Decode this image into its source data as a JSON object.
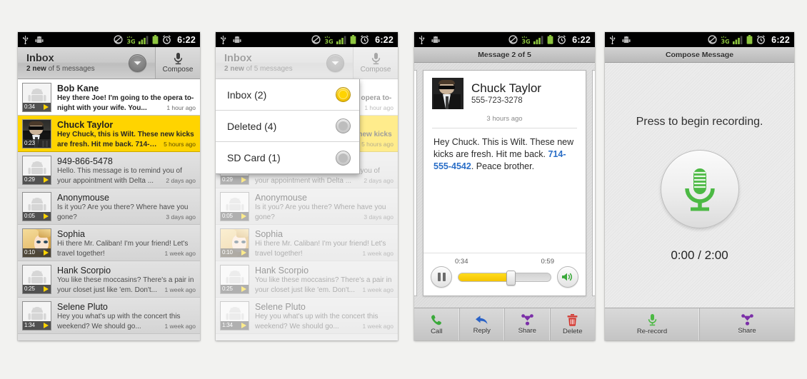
{
  "status_bar": {
    "icons": [
      "usb-icon",
      "android-debug-icon",
      "sync-icon",
      "3g-data-icon",
      "signal-bars-icon",
      "battery-icon",
      "alarm-clock-icon"
    ],
    "time": "6:22"
  },
  "colors": {
    "accent_yellow": "#ffd400",
    "link_blue": "#2a6ec7",
    "call_green": "#3aa93a",
    "reply_blue": "#2a62c7",
    "share_purple": "#7b2fa8",
    "delete_red": "#d33a33",
    "record_green": "#4cb944",
    "status_black": "#000000"
  },
  "panel1": {
    "action_bar": {
      "title": "Inbox",
      "subtitle_bold": "2 new",
      "subtitle_rest": " of 5 messages",
      "dropdown_icon": "chevron-down-icon",
      "compose_icon": "microphone-icon",
      "compose_label": "Compose"
    },
    "messages": [
      {
        "sender": "Bob Kane",
        "preview_line1": "Hey there Joe! I'm going to the opera to-",
        "preview_line2": "night with your wife. You...",
        "time": "1 hour ago",
        "duration": "0:34",
        "avatar": "android-default-avatar",
        "state": "unread",
        "control": "play"
      },
      {
        "sender": "Chuck Taylor",
        "preview_line1": "Hey Chuck, this is Wilt. These new kicks",
        "preview_line2": "are fresh. Hit me back. 714-5...",
        "time": "5 hours ago",
        "duration": "0:23",
        "avatar": "suit-man-photo-avatar",
        "state": "selected",
        "control": "pause"
      },
      {
        "sender": "949-866-5478",
        "preview_line1": "Hello. This message is to remind you of",
        "preview_line2": "your appointment with Delta ...",
        "time": "2 days ago",
        "duration": "0:29",
        "avatar": "android-default-avatar",
        "state": "read",
        "control": "play"
      },
      {
        "sender": "Anonymouse",
        "preview_line1": "Is it you? Are you there? Where have you",
        "preview_line2": "gone?",
        "time": "3 days ago",
        "duration": "0:05",
        "avatar": "android-default-avatar",
        "state": "read",
        "control": "play"
      },
      {
        "sender": "Sophia",
        "preview_line1": "Hi there Mr. Caliban! I'm your friend! Let's",
        "preview_line2": "travel together!",
        "time": "1 week ago",
        "duration": "0:10",
        "avatar": "anime-girl-photo-avatar",
        "state": "read",
        "control": "play"
      },
      {
        "sender": "Hank Scorpio",
        "preview_line1": "You like these moccasins? There's a pair in",
        "preview_line2": "your closet just like 'em. Don't...",
        "time": "1 week ago",
        "duration": "0:25",
        "avatar": "android-default-avatar",
        "state": "read",
        "control": "play"
      },
      {
        "sender": "Selene Pluto",
        "preview_line1": "Hey you what's up with the concert this",
        "preview_line2": "weekend? We should go...",
        "time": "1 week ago",
        "duration": "1:34",
        "avatar": "android-default-avatar",
        "state": "read",
        "control": "play"
      }
    ]
  },
  "panel2": {
    "dropdown_items": [
      {
        "label": "Inbox (2)",
        "selected": true
      },
      {
        "label": "Deleted (4)",
        "selected": false
      },
      {
        "label": "SD Card (1)",
        "selected": false
      }
    ]
  },
  "panel3": {
    "title": "Message 2 of 5",
    "contact_name": "Chuck Taylor",
    "contact_phone": "555-723-3278",
    "timestamp": "3 hours ago",
    "message_part1": "Hey Chuck. This is Wilt. These new kicks are fresh. Hit me back. ",
    "message_link": "714-555-4542",
    "message_part2": ". Peace brother.",
    "player": {
      "elapsed": "0:34",
      "total": "0:59",
      "pause_icon": "pause-icon",
      "speaker_icon": "speaker-volume-icon",
      "progress_percent": 56
    },
    "actions": [
      {
        "label": "Call",
        "icon": "phone-handset-icon"
      },
      {
        "label": "Reply",
        "icon": "reply-arrow-icon"
      },
      {
        "label": "Share",
        "icon": "share-icon"
      },
      {
        "label": "Delete",
        "icon": "trash-can-icon"
      }
    ]
  },
  "panel4": {
    "title": "Compose Message",
    "prompt": "Press to begin recording.",
    "record_icon": "microphone-icon",
    "timer": "0:00 / 2:00",
    "actions": [
      {
        "label": "Re-record",
        "icon": "microphone-icon"
      },
      {
        "label": "Share",
        "icon": "share-icon"
      }
    ]
  }
}
